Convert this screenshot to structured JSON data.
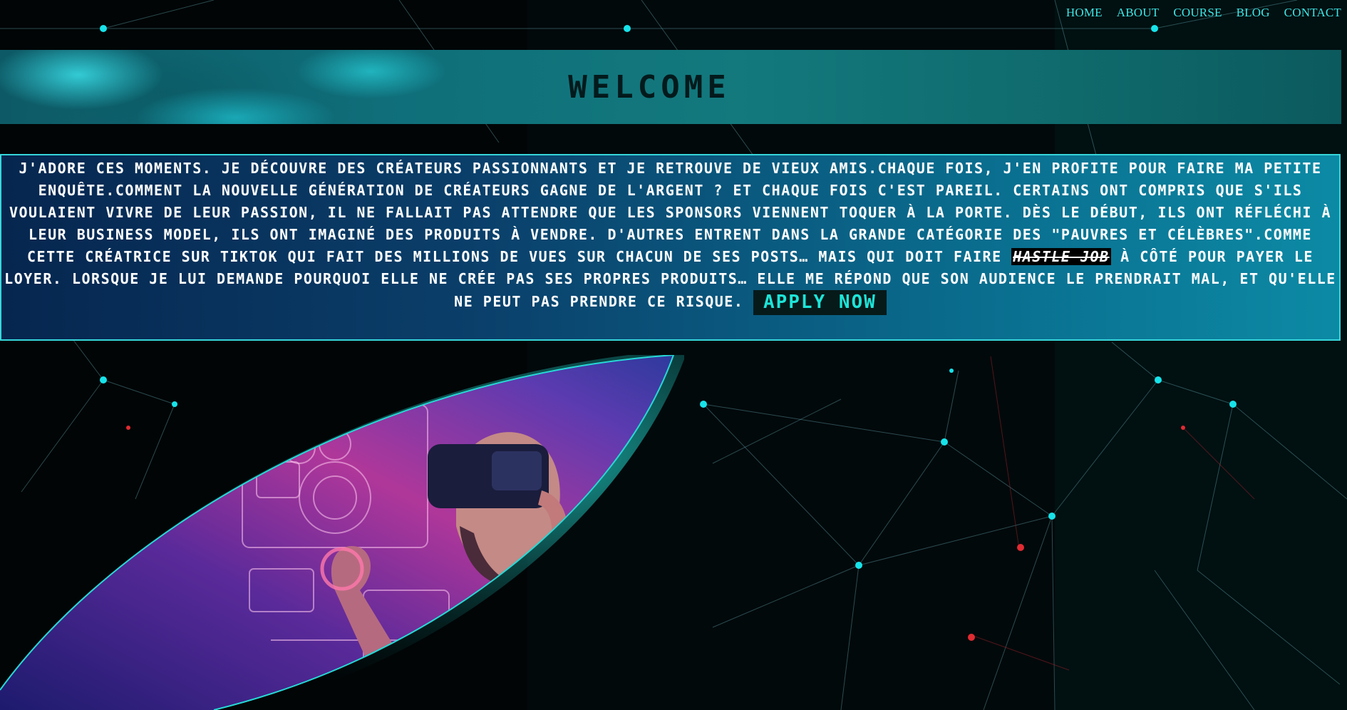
{
  "nav": {
    "items": [
      "HOME",
      "ABOUT",
      "COURSE",
      "BLOG",
      "CONTACT"
    ]
  },
  "banner": {
    "title": "WELCOME"
  },
  "intro": {
    "text_part1": "J'adore ces moments. Je découvre des créateurs passionnants et je retrouve de vieux amis.Chaque fois, j'en profite pour faire ma petite enquête.Comment la nouvelle génération de créateurs gagne de l'argent ? Et chaque fois c'est pareil. Certains ont compris que s'ils voulaient vivre de leur passion, il ne fallait pas attendre que les sponsors viennent toquer à la porte. Dès le début, ils ont réfléchi à leur business model, ils ont imaginé des produits à vendre. D'autres entrent dans la grande catégorie des \"pauvres et célèbres\".Comme cette créatrice sur TikTok qui fait des millions de vues sur chacun de ses posts… mais qui doit faire ",
    "hustle": "hastle job",
    "text_part2": " à côté pour payer le loyer. Lorsque je lui demande pourquoi elle ne crée pas ses propres produits… elle me répond que son audience le prendrait mal, et qu'elle ne peut pas prendre ce risque. ",
    "apply_label": "APPLY NOW"
  },
  "colors": {
    "accent": "#3fe6e6",
    "background": "#02090b",
    "banner": "#0f6f7a",
    "intro_gradient_start": "#06264f",
    "intro_gradient_end": "#0c8aa5",
    "hero_magenta": "#c2379a",
    "hero_violet": "#3a1f8a"
  },
  "hero": {
    "image": "vr-headset-man-futuristic-hud"
  }
}
